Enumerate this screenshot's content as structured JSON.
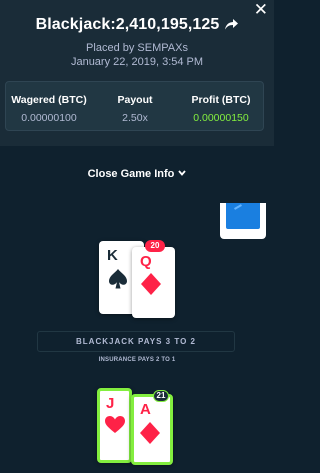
{
  "header": {
    "game_title": "Blackjack:2,410,195,125",
    "placed_by": "Placed by SEMPAXs",
    "date": "January 22, 2019, 3:54 PM"
  },
  "stats": {
    "wagered_label": "Wagered (BTC)",
    "wagered_value": "0.00000100",
    "payout_label": "Payout",
    "payout_value": "2.50x",
    "profit_label": "Profit (BTC)",
    "profit_value": "0.00000150"
  },
  "close_game_info": "Close Game Info",
  "dealer": {
    "total": "20",
    "cards": [
      {
        "rank": "K",
        "suit": "spade"
      },
      {
        "rank": "Q",
        "suit": "diamond"
      }
    ]
  },
  "rules": {
    "payout_rule": "BLACKJACK PAYS 3 TO 2",
    "insurance_rule": "INSURANCE PAYS 2 TO 1"
  },
  "player": {
    "total": "21",
    "cards": [
      {
        "rank": "J",
        "suit": "heart"
      },
      {
        "rank": "A",
        "suit": "diamond"
      }
    ]
  },
  "colors": {
    "background": "#0f212e",
    "panel": "#1a2c38",
    "profit_green": "#83ee3f",
    "card_red": "#fe2247",
    "deck_blue": "#1a7fe0"
  },
  "icons": [
    "close-icon",
    "share-icon",
    "chevron-down-icon",
    "spade-icon",
    "diamond-icon",
    "heart-icon"
  ]
}
